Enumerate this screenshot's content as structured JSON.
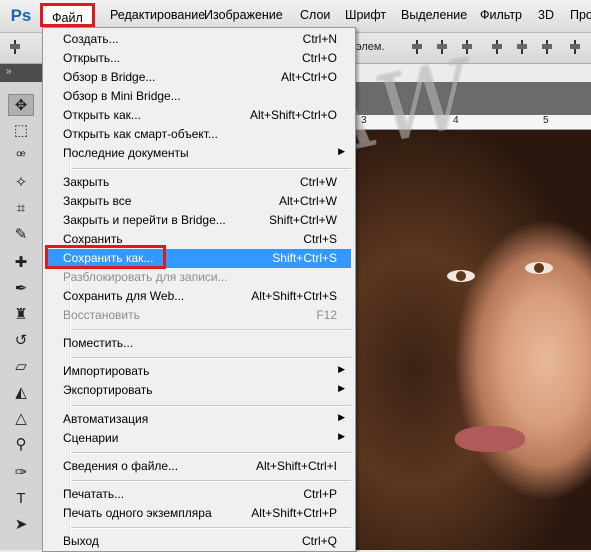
{
  "menubar": {
    "logo": "Ps",
    "items": [
      {
        "label": "Файл"
      },
      {
        "label": "Редактирование"
      },
      {
        "label": "Изображение"
      },
      {
        "label": "Слои"
      },
      {
        "label": "Шрифт"
      },
      {
        "label": "Выделение"
      },
      {
        "label": "Фильтр"
      },
      {
        "label": "3D"
      },
      {
        "label": "Про"
      }
    ]
  },
  "options": {
    "label": "элем."
  },
  "toolstrip": {
    "collapse": "»"
  },
  "tools": [
    {
      "name": "move-tool-icon",
      "glyph": "✥"
    },
    {
      "name": "marquee-tool-icon",
      "glyph": "⬚"
    },
    {
      "name": "lasso-tool-icon",
      "glyph": "ꟹ"
    },
    {
      "name": "quick-select-tool-icon",
      "glyph": "✧"
    },
    {
      "name": "crop-tool-icon",
      "glyph": "⌗"
    },
    {
      "name": "eyedropper-tool-icon",
      "glyph": "✎"
    },
    {
      "name": "healing-brush-tool-icon",
      "glyph": "✚"
    },
    {
      "name": "brush-tool-icon",
      "glyph": "✒"
    },
    {
      "name": "stamp-tool-icon",
      "glyph": "♜"
    },
    {
      "name": "history-brush-tool-icon",
      "glyph": "↺"
    },
    {
      "name": "eraser-tool-icon",
      "glyph": "▱"
    },
    {
      "name": "paint-bucket-tool-icon",
      "glyph": "◭"
    },
    {
      "name": "blur-tool-icon",
      "glyph": "△"
    },
    {
      "name": "dodge-tool-icon",
      "glyph": "⚲"
    },
    {
      "name": "pen-tool-icon",
      "glyph": "✑"
    },
    {
      "name": "type-tool-icon",
      "glyph": "T"
    },
    {
      "name": "path-select-tool-icon",
      "glyph": "➤"
    }
  ],
  "ruler": {
    "ticks": [
      "3",
      "4",
      "5"
    ]
  },
  "watermark": "D-NAW",
  "file_menu": {
    "items": [
      {
        "label": "Создать...",
        "shortcut": "Ctrl+N"
      },
      {
        "label": "Открыть...",
        "shortcut": "Ctrl+O"
      },
      {
        "label": "Обзор в Bridge...",
        "shortcut": "Alt+Ctrl+O"
      },
      {
        "label": "Обзор в Mini Bridge...",
        "shortcut": ""
      },
      {
        "label": "Открыть как...",
        "shortcut": "Alt+Shift+Ctrl+O"
      },
      {
        "label": "Открыть как смарт-объект...",
        "shortcut": ""
      },
      {
        "label": "Последние документы",
        "shortcut": "",
        "submenu": "▶"
      },
      {
        "label": "Закрыть",
        "shortcut": "Ctrl+W"
      },
      {
        "label": "Закрыть все",
        "shortcut": "Alt+Ctrl+W"
      },
      {
        "label": "Закрыть и перейти в Bridge...",
        "shortcut": "Shift+Ctrl+W"
      },
      {
        "label": "Сохранить",
        "shortcut": "Ctrl+S"
      },
      {
        "label": "Сохранить как...",
        "shortcut": "Shift+Ctrl+S",
        "state": "highlighted"
      },
      {
        "label": "Разблокировать для записи...",
        "shortcut": "",
        "state": "disabled"
      },
      {
        "label": "Сохранить для Web...",
        "shortcut": "Alt+Shift+Ctrl+S"
      },
      {
        "label": "Восстановить",
        "shortcut": "F12",
        "state": "disabled"
      },
      {
        "label": "Поместить...",
        "shortcut": ""
      },
      {
        "label": "Импортировать",
        "shortcut": "",
        "submenu": "▶"
      },
      {
        "label": "Экспортировать",
        "shortcut": "",
        "submenu": "▶"
      },
      {
        "label": "Автоматизация",
        "shortcut": "",
        "submenu": "▶"
      },
      {
        "label": "Сценарии",
        "shortcut": "",
        "submenu": "▶"
      },
      {
        "label": "Сведения о файле...",
        "shortcut": "Alt+Shift+Ctrl+I"
      },
      {
        "label": "Печатать...",
        "shortcut": "Ctrl+P"
      },
      {
        "label": "Печать одного экземпляра",
        "shortcut": "Alt+Shift+Ctrl+P"
      },
      {
        "label": "Выход",
        "shortcut": "Ctrl+Q"
      }
    ]
  }
}
